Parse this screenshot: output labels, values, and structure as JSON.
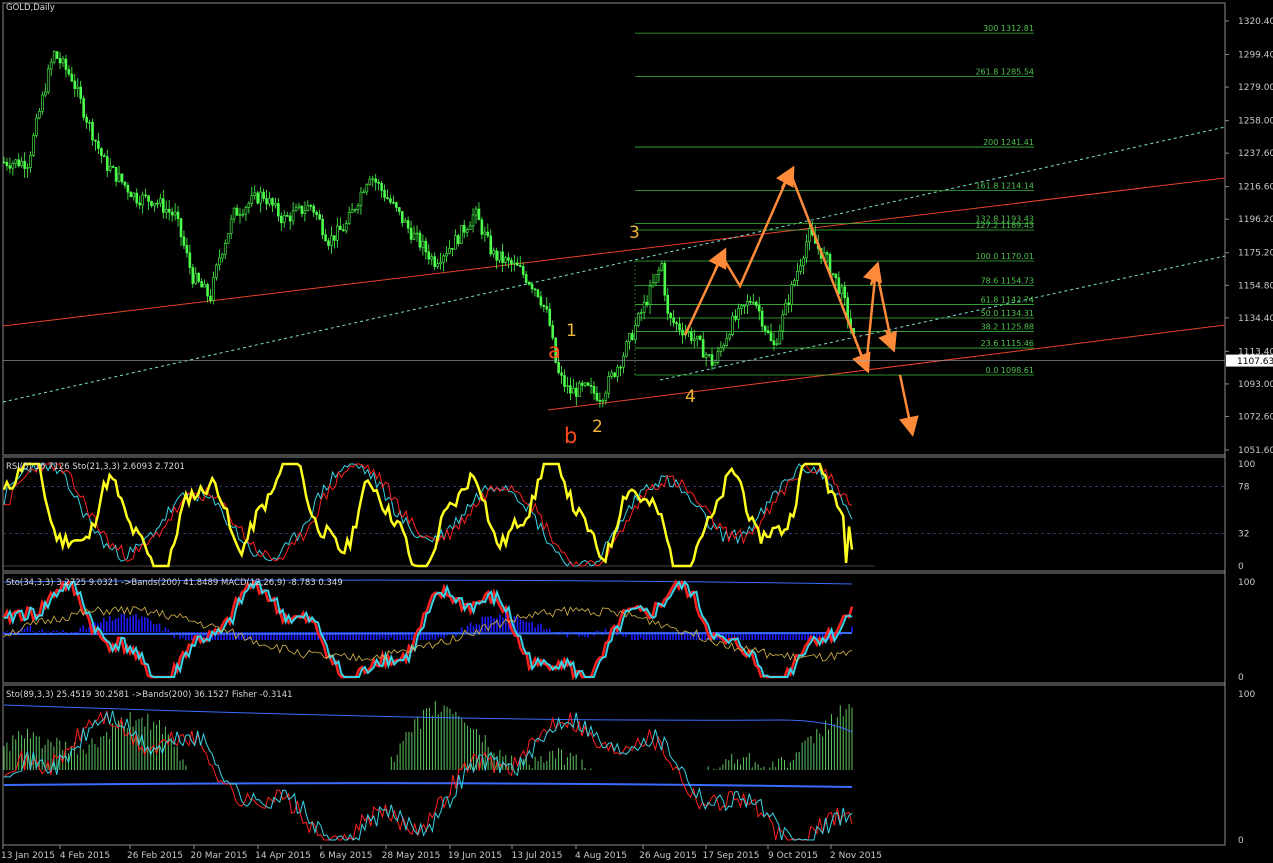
{
  "colors": {
    "background": "#000000",
    "candle": "#4cff4c",
    "channel_red": "#e8402a",
    "channel_cyan": "#7fdfd0",
    "fib": "#3cb83c",
    "arrow": "#ff8a3a",
    "rsi": "#ffff20",
    "stoch_main": "#39d3e6",
    "stoch_signal": "#ff2020",
    "macd_hist": "#1c1cff",
    "band": "#3a6cff",
    "fisher_pos": "#5ec45e",
    "fisher_neg": "#e84040",
    "frame": "#8a8a8a"
  },
  "header": {
    "main_top_text": "GOLD,Daily"
  },
  "price_axis": {
    "labels": [
      "1320.40",
      "1299.40",
      "1279.00",
      "1258.00",
      "1237.60",
      "1216.60",
      "1196.20",
      "1175.20",
      "1154.80",
      "1134.40",
      "1113.40",
      "1093.00",
      "1072.60",
      "1051.60"
    ],
    "current_price": "1107.63"
  },
  "time_axis": {
    "labels": [
      "13 Jan 2015",
      "4 Feb 2015",
      "26 Feb 2015",
      "20 Mar 2015",
      "14 Apr 2015",
      "6 May 2015",
      "28 May 2015",
      "19 Jun 2015",
      "13 Jul 2015",
      "4 Aug 2015",
      "26 Aug 2015",
      "17 Sep 2015",
      "9 Oct 2015",
      "2 Nov 2015"
    ]
  },
  "fibonacci": [
    {
      "label": "300  1312.81",
      "price": 1312.81
    },
    {
      "label": "261.8  1285.54",
      "price": 1285.54
    },
    {
      "label": "200  1241.41",
      "price": 1241.41
    },
    {
      "label": "161.8  1214.14",
      "price": 1214.14
    },
    {
      "label": "132.8  1193.43",
      "price": 1193.43
    },
    {
      "label": "127.2  1189.43",
      "price": 1189.43
    },
    {
      "label": "100.0  1170.01",
      "price": 1170.01
    },
    {
      "label": "78.6  1154.73",
      "price": 1154.73
    },
    {
      "label": "61.8  1142.74",
      "price": 1142.74
    },
    {
      "label": "50.0  1134.31",
      "price": 1134.31
    },
    {
      "label": "38.2  1125.88",
      "price": 1125.88
    },
    {
      "label": "23.6  1115.46",
      "price": 1115.46
    },
    {
      "label": "0.0  1098.61",
      "price": 1098.61
    }
  ],
  "wave_labels": [
    {
      "text": "a",
      "kind": "red"
    },
    {
      "text": "1",
      "kind": "gold"
    },
    {
      "text": "b",
      "kind": "red"
    },
    {
      "text": "2",
      "kind": "gold"
    },
    {
      "text": "3",
      "kind": "gold"
    },
    {
      "text": "4",
      "kind": "gold"
    }
  ],
  "indicators": {
    "rsi": {
      "header": "RSI(5) 16.7126   Sto(21,3,3) 2.6093 2.7201",
      "scale": [
        "100",
        "78",
        "32",
        "0"
      ]
    },
    "macd": {
      "header": "Sto(34,3,3) 3.2725 9.0321   ->Bands(200) 41.8489   MACD(12,26,9) -8.783 0.349",
      "scale": [
        "100",
        "0"
      ]
    },
    "fisher": {
      "header": "Sto(89,3,3) 25.4519 30.2581   ->Bands(200) 36.1527   Fisher -0.3141",
      "scale": [
        "100",
        "0"
      ]
    }
  },
  "chart_data": {
    "type": "candlestick",
    "instrument": "GOLD",
    "timeframe": "Daily",
    "ylim": [
      1051.6,
      1330
    ],
    "price_path": [
      {
        "date": "13 Jan 2015",
        "price": 1232
      },
      {
        "date": "20 Jan 2015",
        "price": 1282
      },
      {
        "date": "23 Jan 2015",
        "price": 1300
      },
      {
        "date": "30 Jan 2015",
        "price": 1285
      },
      {
        "date": "4 Feb 2015",
        "price": 1262
      },
      {
        "date": "10 Feb 2015",
        "price": 1232
      },
      {
        "date": "20 Feb 2015",
        "price": 1210
      },
      {
        "date": "26 Feb 2015",
        "price": 1208
      },
      {
        "date": "5 Mar 2015",
        "price": 1198
      },
      {
        "date": "11 Mar 2015",
        "price": 1160
      },
      {
        "date": "17 Mar 2015",
        "price": 1147
      },
      {
        "date": "20 Mar 2015",
        "price": 1172
      },
      {
        "date": "26 Mar 2015",
        "price": 1200
      },
      {
        "date": "6 Apr 2015",
        "price": 1212
      },
      {
        "date": "14 Apr 2015",
        "price": 1196
      },
      {
        "date": "24 Apr 2015",
        "price": 1205
      },
      {
        "date": "30 Apr 2015",
        "price": 1183
      },
      {
        "date": "6 May 2015",
        "price": 1192
      },
      {
        "date": "14 May 2015",
        "price": 1225
      },
      {
        "date": "21 May 2015",
        "price": 1207
      },
      {
        "date": "28 May 2015",
        "price": 1188
      },
      {
        "date": "5 Jun 2015",
        "price": 1170
      },
      {
        "date": "12 Jun 2015",
        "price": 1182
      },
      {
        "date": "19 Jun 2015",
        "price": 1200
      },
      {
        "date": "26 Jun 2015",
        "price": 1174
      },
      {
        "date": "6 Jul 2015",
        "price": 1165
      },
      {
        "date": "13 Jul 2015",
        "price": 1152
      },
      {
        "date": "17 Jul 2015",
        "price": 1134
      },
      {
        "date": "20 Jul 2015",
        "price": 1100
      },
      {
        "date": "24 Jul 2015",
        "price": 1088
      },
      {
        "date": "30 Jul 2015",
        "price": 1090
      },
      {
        "date": "4 Aug 2015",
        "price": 1085
      },
      {
        "date": "11 Aug 2015",
        "price": 1110
      },
      {
        "date": "20 Aug 2015",
        "price": 1150
      },
      {
        "date": "24 Aug 2015",
        "price": 1168
      },
      {
        "date": "26 Aug 2015",
        "price": 1134
      },
      {
        "date": "4 Sep 2015",
        "price": 1122
      },
      {
        "date": "11 Sep 2015",
        "price": 1105
      },
      {
        "date": "17 Sep 2015",
        "price": 1130
      },
      {
        "date": "25 Sep 2015",
        "price": 1148
      },
      {
        "date": "2 Oct 2015",
        "price": 1115
      },
      {
        "date": "9 Oct 2015",
        "price": 1155
      },
      {
        "date": "15 Oct 2015",
        "price": 1187
      },
      {
        "date": "22 Oct 2015",
        "price": 1170
      },
      {
        "date": "28 Oct 2015",
        "price": 1148
      },
      {
        "date": "2 Nov 2015",
        "price": 1115
      },
      {
        "date": "6 Nov 2015",
        "price": 1104
      }
    ],
    "annotations": {
      "projection": "Zig-zag arrow projection: up to ~1227, down to ~1105, up to ~1167, down to ~1057"
    }
  }
}
